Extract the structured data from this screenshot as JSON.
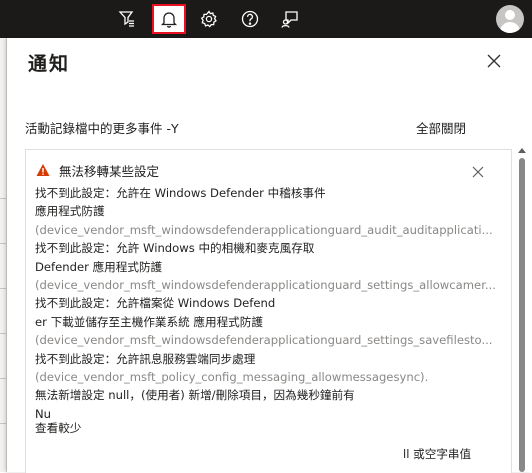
{
  "topbar": {
    "icons": [
      "directory-filter-icon",
      "bell-icon",
      "gear-icon",
      "help-icon",
      "feedback-icon",
      "avatar"
    ]
  },
  "panel": {
    "title": "通知",
    "more_events_link": "活動記錄檔中的更多事件 -Y",
    "close_all_label": "全部關閉"
  },
  "notification": {
    "title": "無法移轉某些設定",
    "lines": [
      "找不到此設定：允許在 Windows Defender 中稽核事件",
      "應用程式防護",
      "(device_vendor_msft_windowsdefenderapplicationguard_audit_auditapplicati...",
      "找不到此設定：允許 Windows 中的相機和麥克風存取",
      "Defender 應用程式防護",
      "(device_vendor_msft_windowsdefenderapplicationguard_settings_allowcamer...",
      "找不到此設定：允許檔案從 Windows Defend",
      "er 下載並儲存至主機作業系統 應用程式防護",
      "(device_vendor_msft_windowsdefenderapplicationguard_settings_savefilesto...",
      "找不到此設定：允許訊息服務雲端同步處理",
      "(device_vendor_msft_policy_config_messaging_allowmessagesync).",
      "無法新增設定 null，(使用者) 新增/刪除項目，因為幾秒鐘前有",
      "Nu"
    ],
    "show_less": "查看較少",
    "trailing_text": "ll 或空字串值"
  },
  "colors": {
    "topbar_bg": "#1b1a19",
    "active_outline": "#e81123",
    "warning": "#d83b01",
    "grey_text": "#8a8886"
  }
}
